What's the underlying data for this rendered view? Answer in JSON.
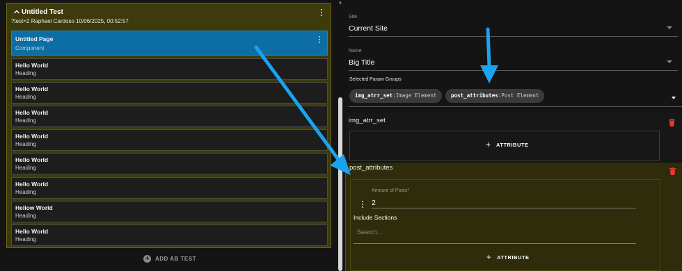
{
  "test": {
    "title": "Untitled Test",
    "subtitle": "?test=2 Raphael Cardoso 10/06/2025, 00:52:57"
  },
  "items": [
    {
      "title": "Untitled Page",
      "sub": "Component"
    },
    {
      "title": "Hello World",
      "sub": "Heading"
    },
    {
      "title": "Hello World",
      "sub": "Heading"
    },
    {
      "title": "Hello World",
      "sub": "Heading"
    },
    {
      "title": "Hello World",
      "sub": "Heading"
    },
    {
      "title": "Hello World",
      "sub": "Heading"
    },
    {
      "title": "Hello World",
      "sub": "Heading"
    },
    {
      "title": "Hellow World",
      "sub": "Heading"
    },
    {
      "title": "Hello World",
      "sub": "Heading"
    }
  ],
  "add_ab_label": "ADD AB TEST",
  "site": {
    "label": "Site",
    "value": "Current Site"
  },
  "name": {
    "label": "Name",
    "value": "Big Title"
  },
  "param_groups": {
    "label": "Selected Param Groups",
    "chips": [
      {
        "key": "img_atrr_set",
        "sep": ":",
        "desc": "Image Element"
      },
      {
        "key": "post_attributes",
        "sep": ":",
        "desc": "Post Element"
      }
    ]
  },
  "group1": {
    "title": "img_atrr_set",
    "attr_label": "ATTRIBUTE"
  },
  "group2": {
    "title": "post_attributes",
    "amount_label": "Amount of Posts*",
    "amount_value": "2",
    "include_label": "Include Sections",
    "search_placeholder": "Search...",
    "attr_label": "ATTRIBUTE"
  },
  "colors": {
    "selected": "#0d6ea5",
    "test_bg": "#3d3a0c",
    "arrow": "#1aa3f0",
    "trash": "#e53935"
  }
}
